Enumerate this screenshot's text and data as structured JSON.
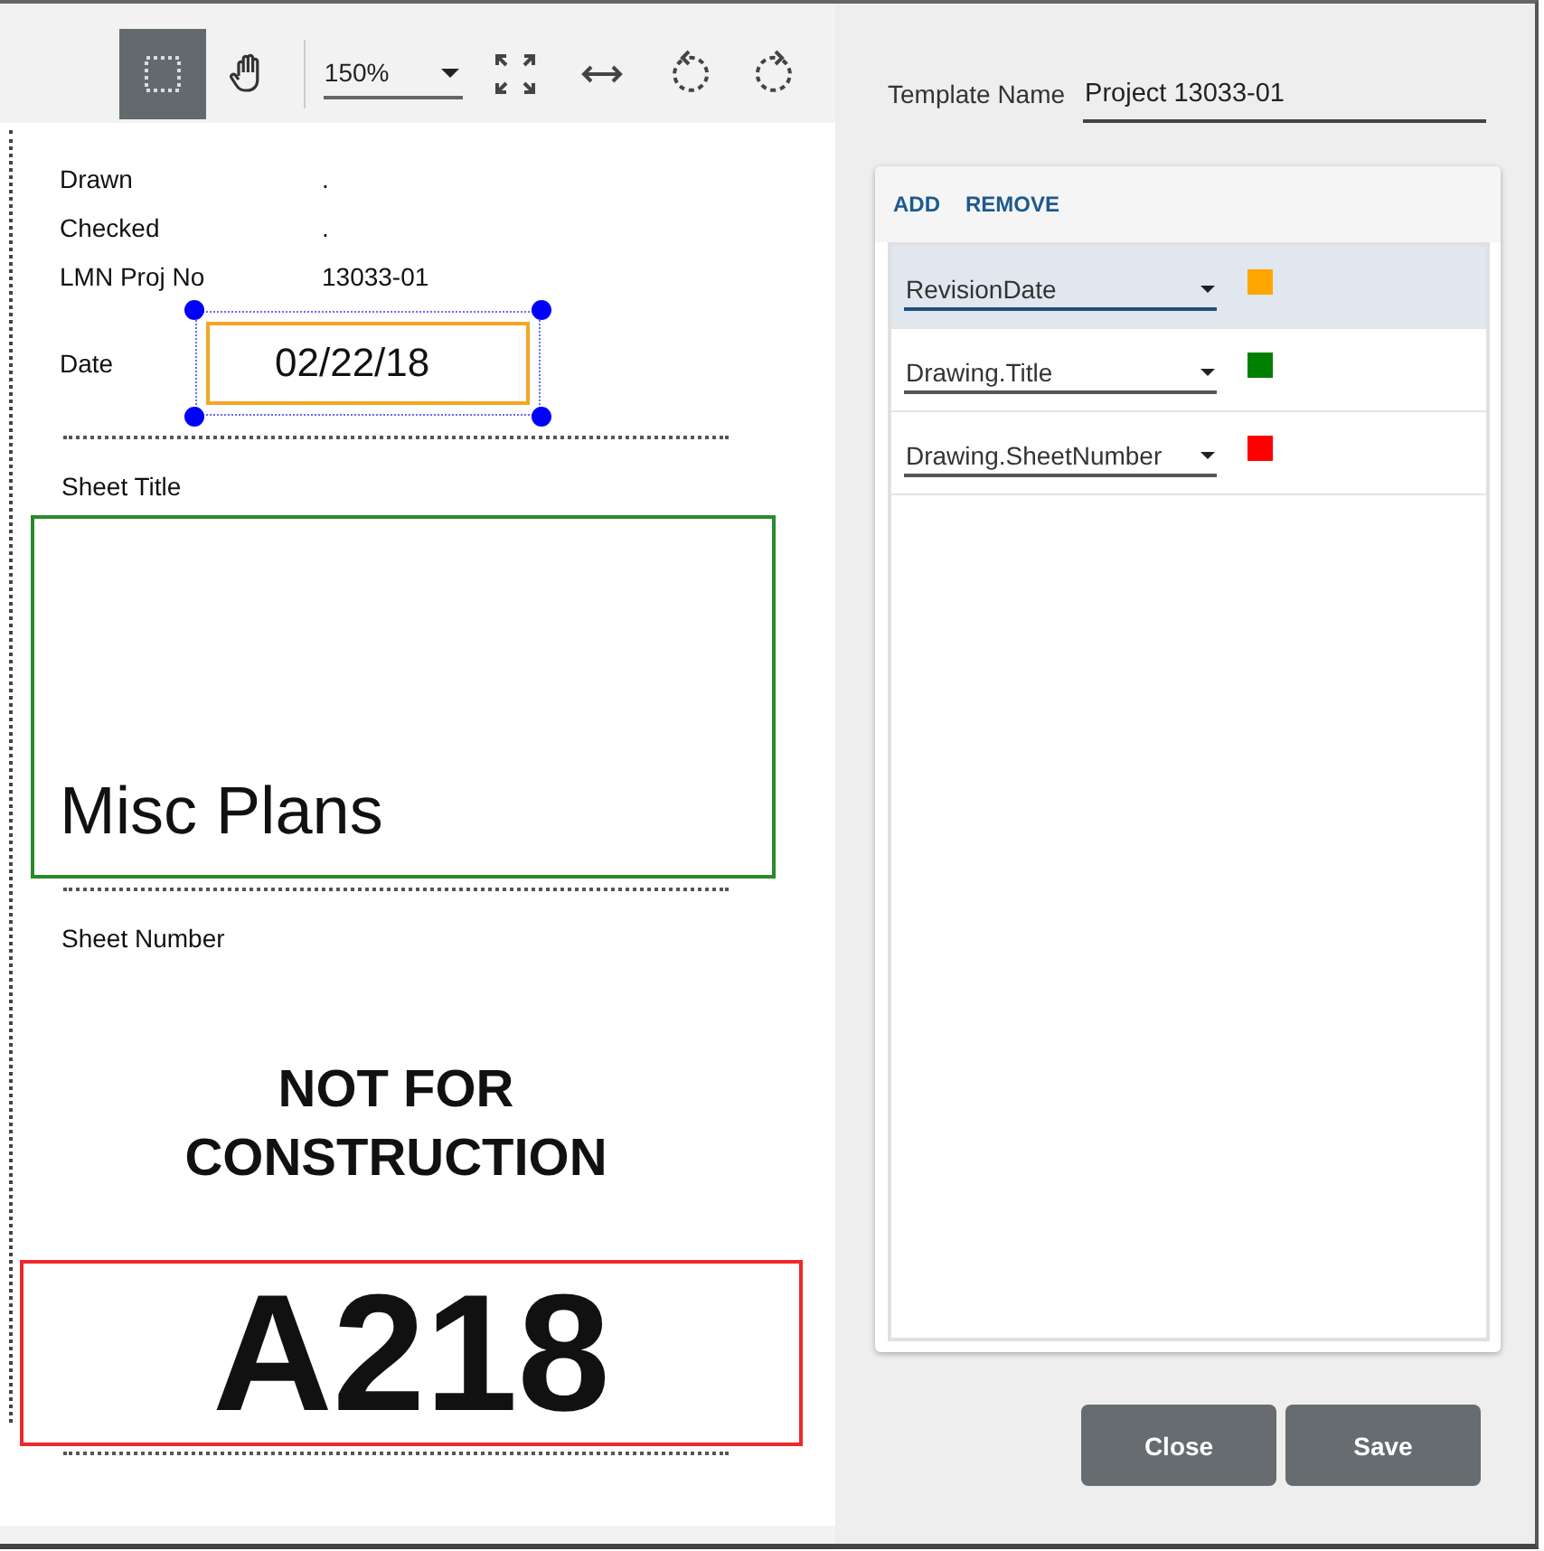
{
  "toolbar": {
    "tools": [
      {
        "kind": "marquee",
        "selected": true
      },
      {
        "kind": "pan",
        "selected": false
      }
    ],
    "zoom": "150%",
    "actions": [
      {
        "kind": "fit"
      },
      {
        "kind": "fit-width"
      },
      {
        "kind": "rotate-left"
      },
      {
        "kind": "rotate-right"
      }
    ]
  },
  "document": {
    "info_rows": [
      {
        "label": "Drawn",
        "value": "."
      },
      {
        "label": "Checked",
        "value": "."
      },
      {
        "label": "LMN Proj No",
        "value": "13033-01"
      }
    ],
    "regions": [
      {
        "kind": "date",
        "label": "Date",
        "value": "02/22/18",
        "color": "#f5a623",
        "selected": true
      },
      {
        "kind": "title",
        "label": "Sheet Title",
        "value": "Misc Plans",
        "color": "#2a8a2a"
      },
      {
        "kind": "number",
        "label": "Sheet Number",
        "note": "NOT FOR CONSTRUCTION",
        "value": "A218",
        "color": "#f02828"
      }
    ]
  },
  "panel": {
    "template_label": "Template Name",
    "template_value": "Project 13033-01",
    "actions": [
      "ADD",
      "REMOVE"
    ],
    "mappings": [
      {
        "field": "RevisionDate",
        "color": "#ffa500",
        "selected": true
      },
      {
        "field": "Drawing.Title",
        "color": "#008000",
        "selected": false
      },
      {
        "field": "Drawing.SheetNumber",
        "color": "#ff0000",
        "selected": false
      }
    ],
    "buttons": [
      "Close",
      "Save"
    ]
  }
}
